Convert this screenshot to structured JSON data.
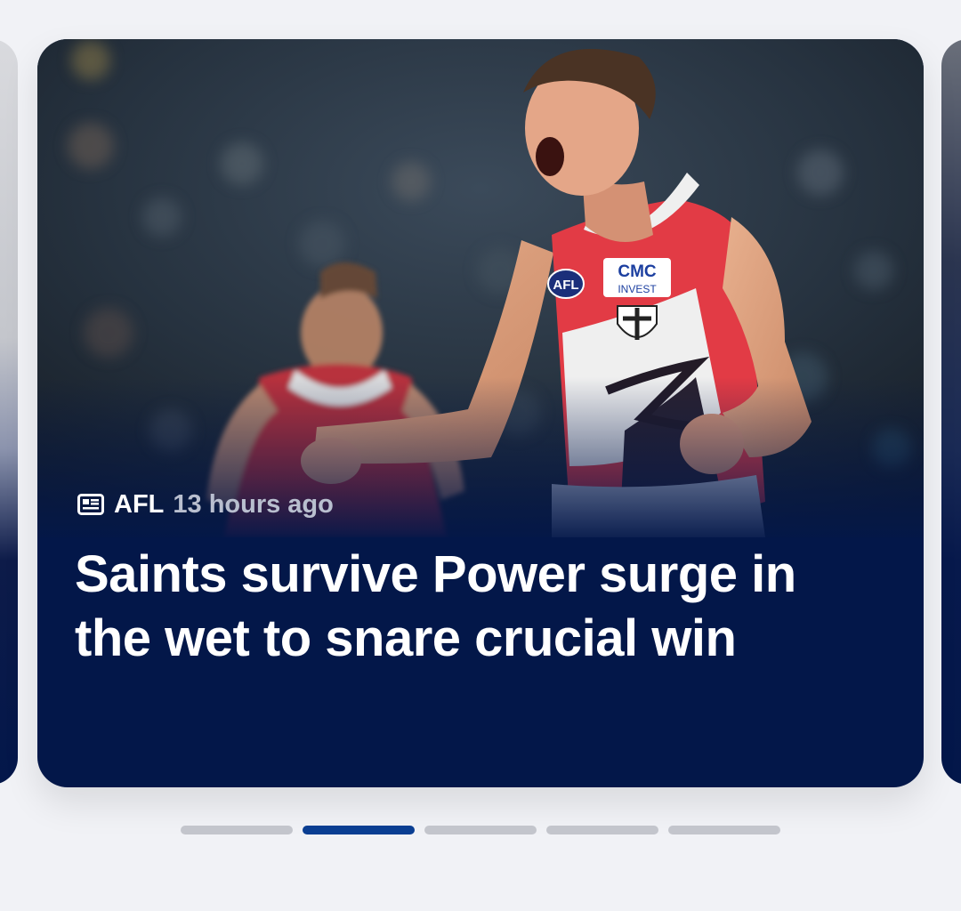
{
  "article": {
    "category": "AFL",
    "time_ago": "13 hours ago",
    "headline": "Saints survive Power surge in the wet to snare crucial win",
    "category_icon": "newspaper-icon",
    "image": {
      "subject": "footballer-celebrating",
      "jersey_sponsor_line1": "CMC",
      "jersey_sponsor_line2": "INVEST",
      "jersey_logo": "AFL"
    }
  },
  "carousel": {
    "total_pages": 5,
    "active_index": 1
  },
  "colors": {
    "page_background": "#f1f2f6",
    "card_background": "#031749",
    "active_indicator": "#0a3e92",
    "inactive_indicator": "#c3c5cc",
    "headline_text": "#ffffff",
    "time_text": "#b9bfcf"
  }
}
